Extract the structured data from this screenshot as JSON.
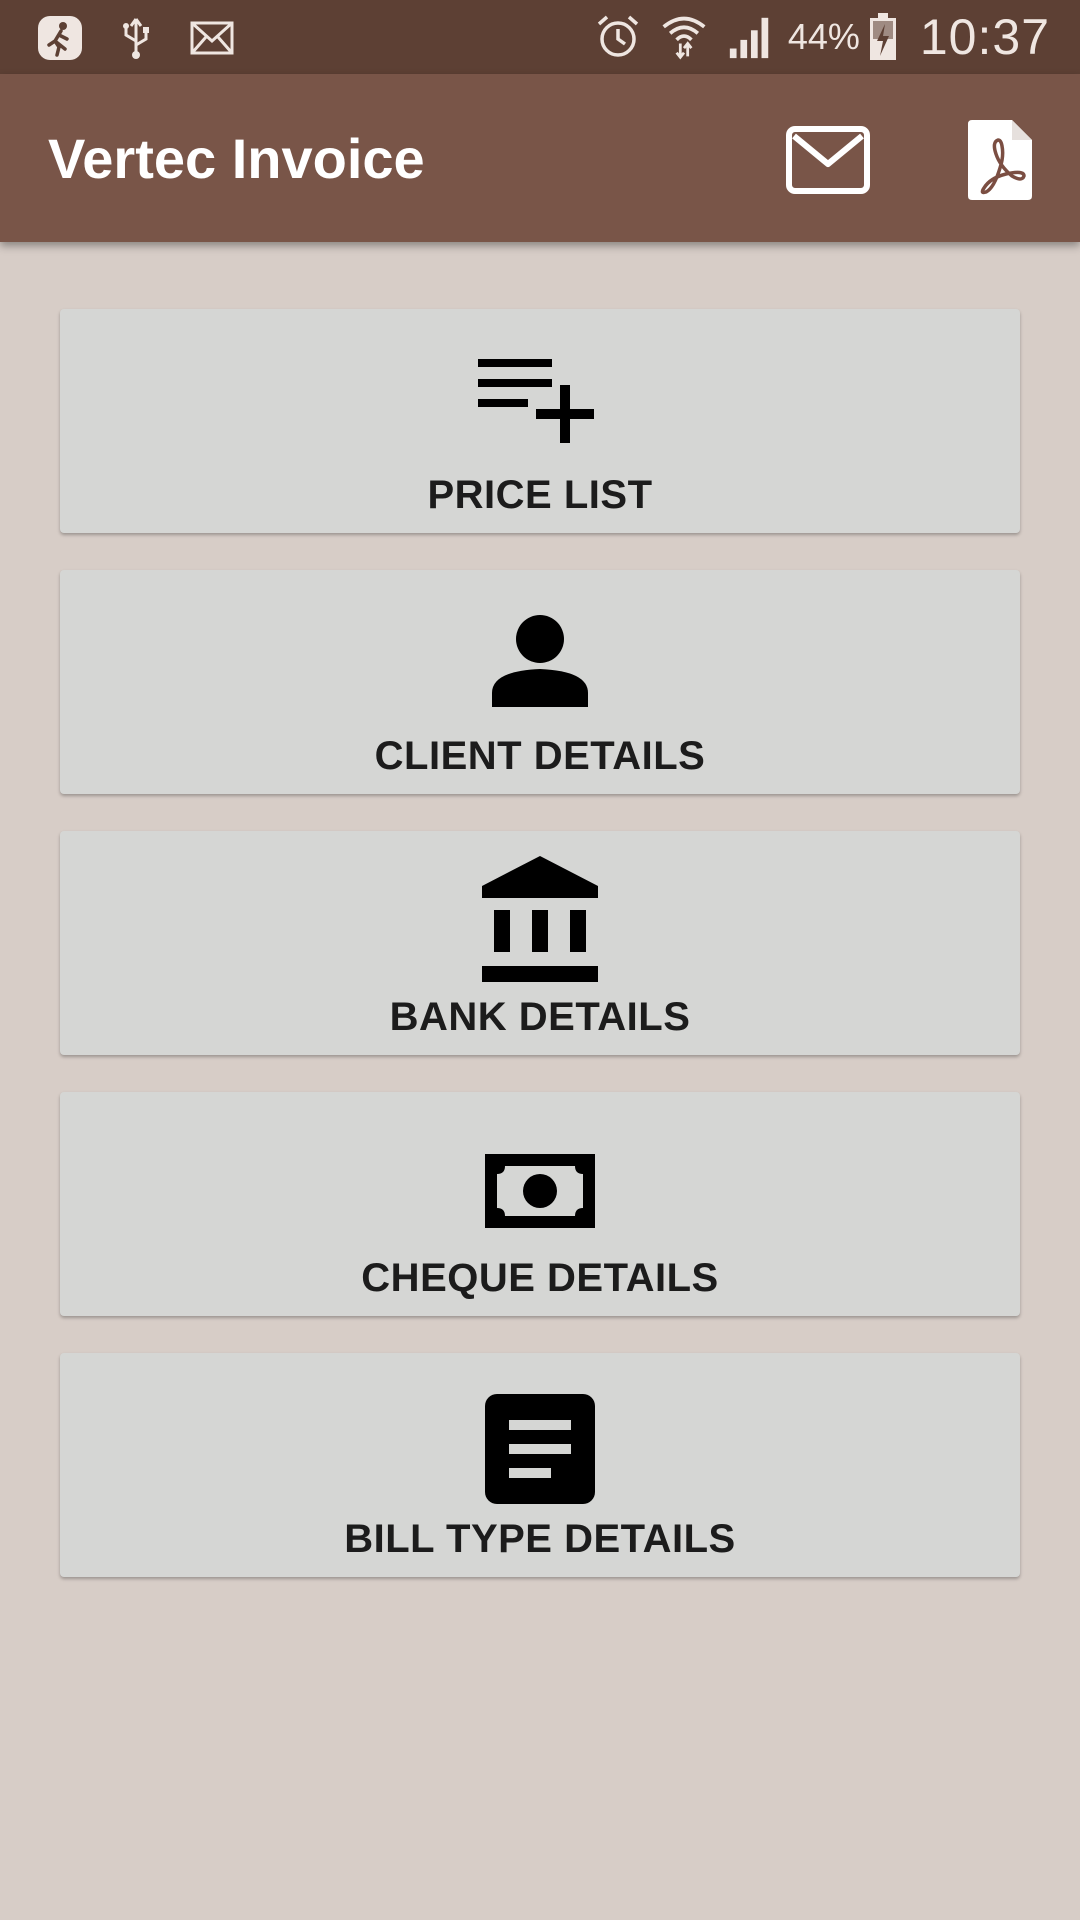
{
  "status_bar": {
    "battery_percent": "44%",
    "time": "10:37",
    "left_icons": [
      "fitness-app-icon",
      "usb-icon",
      "email-notification-icon"
    ],
    "right_icons": [
      "alarm-icon",
      "wifi-icon",
      "signal-icon",
      "battery-charging-icon"
    ]
  },
  "app_bar": {
    "title": "Vertec Invoice",
    "actions": [
      "mail-icon",
      "pdf-icon"
    ]
  },
  "menu": {
    "items": [
      {
        "label": "PRICE LIST",
        "icon": "playlist-add-icon"
      },
      {
        "label": "CLIENT DETAILS",
        "icon": "person-icon"
      },
      {
        "label": "BANK DETAILS",
        "icon": "bank-icon"
      },
      {
        "label": "CHEQUE DETAILS",
        "icon": "money-icon"
      },
      {
        "label": "BILL TYPE DETAILS",
        "icon": "document-icon"
      }
    ]
  },
  "colors": {
    "status_bar": "#5d4034",
    "app_bar": "#795548",
    "background": "#d7cdc7",
    "card": "#d5d6d4"
  }
}
